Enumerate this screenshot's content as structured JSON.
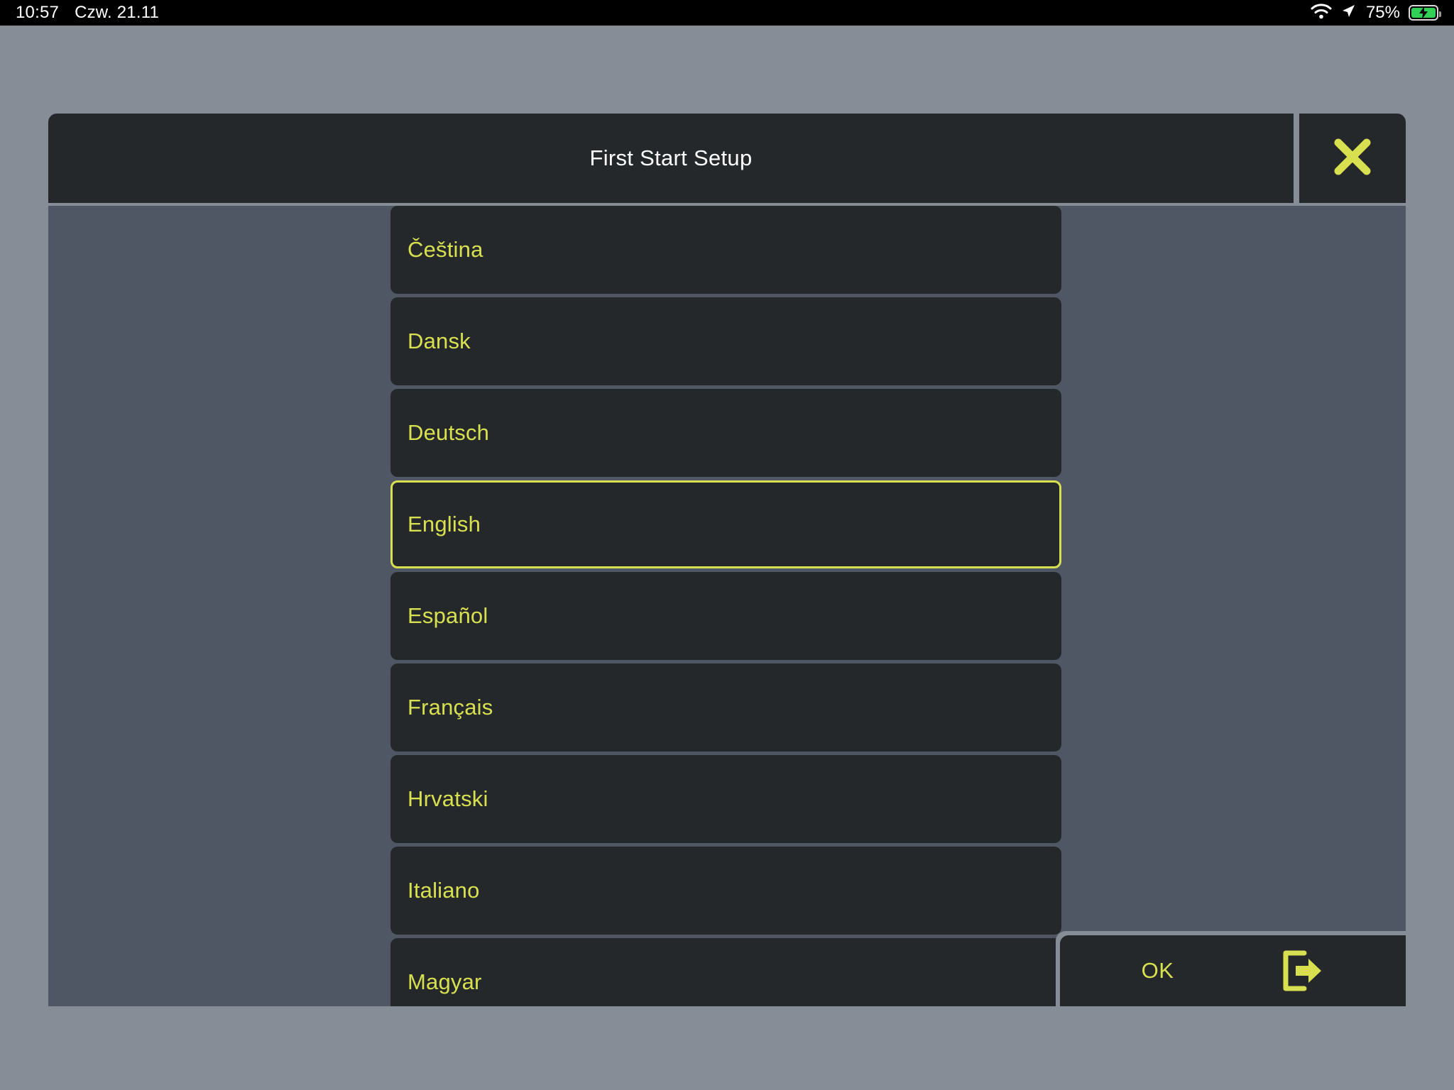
{
  "statusbar": {
    "time": "10:57",
    "date": "Czw. 21.11",
    "battery_percent": "75%",
    "wifi_icon": "wifi-icon",
    "location_icon": "location-arrow-icon",
    "battery_icon": "battery-charging-icon",
    "battery_color": "#31d158",
    "background": "#000000"
  },
  "dialog": {
    "title": "First Start Setup",
    "close_icon": "close-x-icon",
    "accent_color": "#d9e04f",
    "panel_color": "#24282b",
    "body_color": "#4e5763",
    "page_background": "#868d96",
    "languages": [
      {
        "label": "Čeština",
        "selected": false
      },
      {
        "label": "Dansk",
        "selected": false
      },
      {
        "label": "Deutsch",
        "selected": false
      },
      {
        "label": "English",
        "selected": true
      },
      {
        "label": "Español",
        "selected": false
      },
      {
        "label": "Français",
        "selected": false
      },
      {
        "label": "Hrvatski",
        "selected": false
      },
      {
        "label": "Italiano",
        "selected": false
      },
      {
        "label": "Magyar",
        "selected": false
      }
    ],
    "ok": {
      "label": "OK",
      "icon": "exit-arrow-icon"
    }
  }
}
